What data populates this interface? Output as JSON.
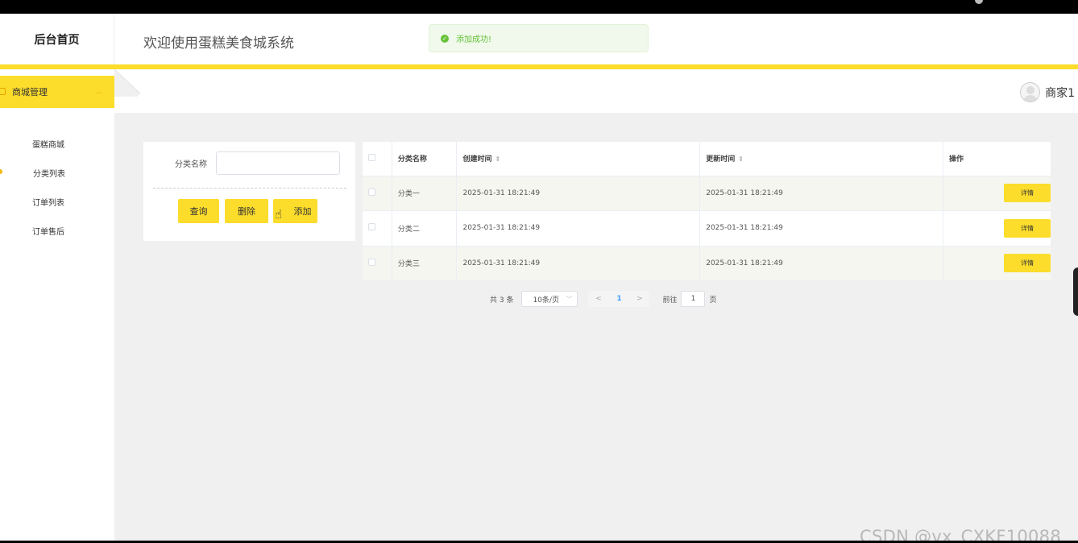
{
  "header": {
    "brand": "后台首页",
    "title": "欢迎使用蛋糕美食城系统",
    "toast": {
      "message": "添加成功!",
      "type": "success",
      "color": "#67c23a"
    }
  },
  "theme": {
    "accent": "#fcdd2b",
    "background": "#f0f0f0"
  },
  "sidebar": {
    "group_label": "商城管理",
    "items": [
      {
        "label": "蛋糕商城",
        "active": false
      },
      {
        "label": "分类列表",
        "active": true
      },
      {
        "label": "订单列表",
        "active": false
      },
      {
        "label": "订单售后",
        "active": false
      }
    ]
  },
  "user": {
    "name": "商家1",
    "avatar_icon": "user-avatar-icon"
  },
  "search": {
    "label": "分类名称",
    "value": "",
    "buttons": {
      "query": "查询",
      "delete": "删除",
      "add": "添加"
    }
  },
  "table": {
    "columns": {
      "name": "分类名称",
      "created": "创建时间",
      "updated": "更新时间",
      "actions": "操作"
    },
    "sort_icon": "⇕",
    "rows": [
      {
        "name": "分类一",
        "created": "2025-01-31 18:21:49",
        "updated": "2025-01-31 18:21:49",
        "action": "详情"
      },
      {
        "name": "分类二",
        "created": "2025-01-31 18:21:49",
        "updated": "2025-01-31 18:21:49",
        "action": "详情"
      },
      {
        "name": "分类三",
        "created": "2025-01-31 18:21:49",
        "updated": "2025-01-31 18:21:49",
        "action": "详情"
      }
    ]
  },
  "pagination": {
    "total": "共 3 条",
    "page_size": "10条/页",
    "prev": "<",
    "current": "1",
    "next": ">",
    "goto_prefix": "前往",
    "goto_value": "1",
    "goto_suffix": "页"
  },
  "watermark": "CSDN @vx_CXKF10088"
}
